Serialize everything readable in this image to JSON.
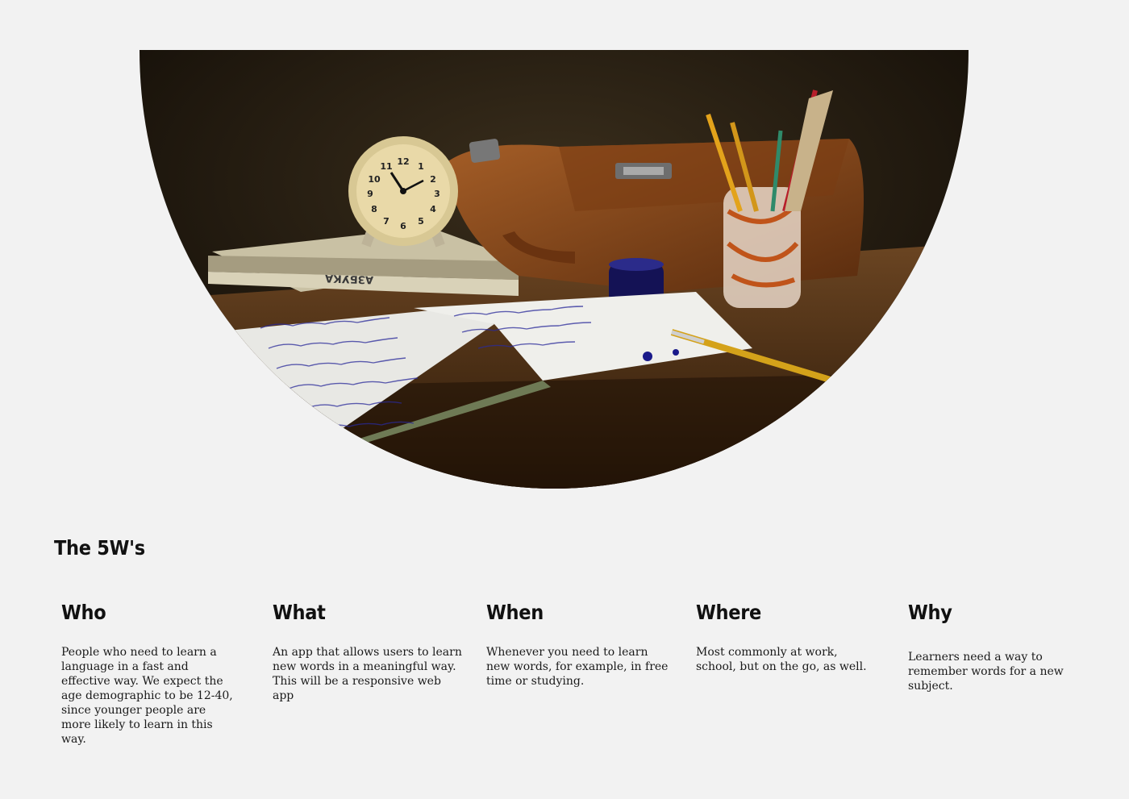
{
  "section": {
    "title": "The 5W's"
  },
  "columns": [
    {
      "heading": "Who",
      "body": "People who need to learn a language in a fast and effective way. We expect the age demographic to be 12-40, since younger people are more likely to learn in this way."
    },
    {
      "heading": "What",
      "body": "An app that allows users to learn new words in a meaningful way. This will be a responsive web app"
    },
    {
      "heading": "When",
      "body": "Whenever you need to learn new words, for example, in free time or studying."
    },
    {
      "heading": "Where",
      "body": "Most commonly at work, school, but on the go, as well."
    },
    {
      "heading": "Why",
      "body": "Learners need a way to remember words for a new subject."
    }
  ],
  "hero": {
    "clock_numbers": [
      "12",
      "1",
      "2",
      "3",
      "4",
      "5",
      "6",
      "7",
      "8",
      "9",
      "10",
      "11"
    ],
    "book_label": "АЗБУКА",
    "colors": {
      "background": "#f2f2f2",
      "desk": "#5a3a1d",
      "wall": "#2a2014",
      "bag": "#8a4a1e",
      "ink": "#1a1a8a",
      "clock": "#e9d9a8"
    }
  }
}
